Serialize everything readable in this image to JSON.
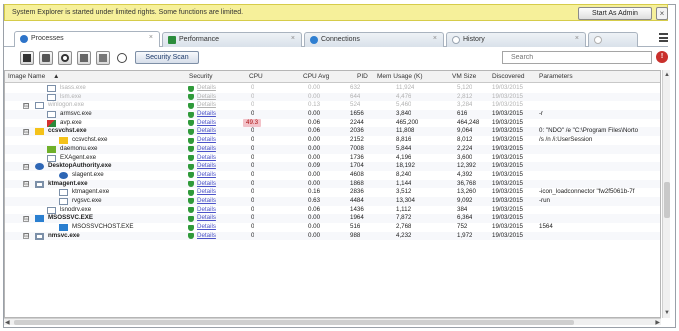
{
  "notice": {
    "text": "System Explorer is started under limited rights. Some functions are limited.",
    "admin_button": "Start As Admin",
    "close_button": "×"
  },
  "tabs": [
    {
      "label": "Processes",
      "icon_color": "#2e74c9",
      "active": true
    },
    {
      "label": "Performance",
      "icon_color": "#2b8c3c",
      "active": false
    },
    {
      "label": "Connections",
      "icon_color": "#2f7fd1",
      "active": false
    },
    {
      "label": "History",
      "icon_color": "#9aa5b1",
      "active": false
    },
    {
      "label": "",
      "icon_color": "#b0b0b0",
      "active": false
    }
  ],
  "tab_close_glyph": "×",
  "toolbar": {
    "scan_button": "Security Scan",
    "search_placeholder": "Search",
    "search_icon": "!"
  },
  "grid": {
    "columns": [
      "Image Name",
      "Security",
      "CPU",
      "CPU Avg",
      "PID",
      "Mem Usage (K)",
      "VM Size",
      "Discovered",
      "Parameters"
    ],
    "rows": [
      {
        "name": "lsass.exe",
        "indent": 1,
        "expander": "",
        "icon": "window",
        "faded": true,
        "bold": false,
        "security": "Details",
        "cpu": "0",
        "cpu_avg": "0.00",
        "pid": "632",
        "mem": "11,924",
        "vm": "5,120",
        "discovered": "19/03/2015",
        "params": ""
      },
      {
        "name": "lsm.exe",
        "indent": 1,
        "expander": "",
        "icon": "window",
        "faded": true,
        "bold": false,
        "security": "Details",
        "cpu": "0",
        "cpu_avg": "0.00",
        "pid": "644",
        "mem": "4,476",
        "vm": "2,812",
        "discovered": "19/03/2015",
        "params": ""
      },
      {
        "name": "winlogon.exe",
        "indent": 0,
        "expander": "⊟",
        "icon": "window",
        "faded": true,
        "bold": false,
        "security": "Details",
        "cpu": "0",
        "cpu_avg": "0.13",
        "pid": "524",
        "mem": "5,460",
        "vm": "3,284",
        "discovered": "19/03/2015",
        "params": ""
      },
      {
        "name": "armsvc.exe",
        "indent": 1,
        "expander": "",
        "icon": "window",
        "faded": false,
        "bold": false,
        "security": "Details",
        "cpu": "0",
        "cpu_avg": "0.00",
        "pid": "1656",
        "mem": "3,840",
        "vm": "616",
        "discovered": "19/03/2015",
        "params": "-r"
      },
      {
        "name": "avp.exe",
        "indent": 1,
        "expander": "",
        "icon": "kaspersky",
        "faded": false,
        "bold": false,
        "security": "Details",
        "cpu": "49.3",
        "cpu_avg": "0.06",
        "pid": "2244",
        "mem": "465,200",
        "vm": "464,248",
        "discovered": "19/03/2015",
        "params": ""
      },
      {
        "name": "ccsvchst.exe",
        "indent": 0,
        "expander": "⊟",
        "icon": "check",
        "faded": false,
        "bold": true,
        "security": "Details",
        "cpu": "0",
        "cpu_avg": "0.06",
        "pid": "2036",
        "mem": "11,808",
        "vm": "9,064",
        "discovered": "19/03/2015",
        "params": "0: \"NDO\" /e \"C:\\Program Files\\Norto"
      },
      {
        "name": "ccsvchst.exe",
        "indent": 2,
        "expander": "",
        "icon": "check",
        "faded": false,
        "bold": false,
        "security": "Details",
        "cpu": "0",
        "cpu_avg": "0.00",
        "pid": "2152",
        "mem": "8,816",
        "vm": "8,012",
        "discovered": "19/03/2015",
        "params": "/s /n /i:UserSession"
      },
      {
        "name": "daemonu.exe",
        "indent": 1,
        "expander": "",
        "icon": "nvidia",
        "faded": false,
        "bold": false,
        "security": "Details",
        "cpu": "0",
        "cpu_avg": "0.00",
        "pid": "7008",
        "mem": "5,844",
        "vm": "2,224",
        "discovered": "19/03/2015",
        "params": ""
      },
      {
        "name": "EXAgent.exe",
        "indent": 1,
        "expander": "",
        "icon": "window",
        "faded": false,
        "bold": false,
        "security": "Details",
        "cpu": "0",
        "cpu_avg": "0.00",
        "pid": "1736",
        "mem": "4,196",
        "vm": "3,600",
        "discovered": "19/03/2015",
        "params": ""
      },
      {
        "name": "DesktopAuthority.exe",
        "indent": 0,
        "expander": "⊟",
        "icon": "globe",
        "faded": false,
        "bold": true,
        "security": "Details",
        "cpu": "0",
        "cpu_avg": "0.09",
        "pid": "1704",
        "mem": "18,192",
        "vm": "12,392",
        "discovered": "19/03/2015",
        "params": ""
      },
      {
        "name": "slagent.exe",
        "indent": 2,
        "expander": "",
        "icon": "globe",
        "faded": false,
        "bold": false,
        "security": "Details",
        "cpu": "0",
        "cpu_avg": "0.00",
        "pid": "4608",
        "mem": "8,240",
        "vm": "4,392",
        "discovered": "19/03/2015",
        "params": ""
      },
      {
        "name": "ktmagent.exe",
        "indent": 0,
        "expander": "⊟",
        "icon": "window",
        "faded": false,
        "bold": true,
        "security": "Details",
        "cpu": "0",
        "cpu_avg": "0.00",
        "pid": "1868",
        "mem": "1,144",
        "vm": "36,768",
        "discovered": "19/03/2015",
        "params": ""
      },
      {
        "name": "ktmagent.exe",
        "indent": 2,
        "expander": "",
        "icon": "window",
        "faded": false,
        "bold": false,
        "security": "Details",
        "cpu": "0",
        "cpu_avg": "0.16",
        "pid": "2836",
        "mem": "3,512",
        "vm": "13,260",
        "discovered": "19/03/2015",
        "params": "-icon_loadconnector \"fw2f5061b-7f"
      },
      {
        "name": "rvgsvc.exe",
        "indent": 2,
        "expander": "",
        "icon": "window",
        "faded": false,
        "bold": false,
        "security": "Details",
        "cpu": "0",
        "cpu_avg": "0.63",
        "pid": "4484",
        "mem": "13,304",
        "vm": "9,092",
        "discovered": "19/03/2015",
        "params": "-run"
      },
      {
        "name": "lsnodrv.exe",
        "indent": 1,
        "expander": "",
        "icon": "window",
        "faded": false,
        "bold": false,
        "security": "Details",
        "cpu": "0",
        "cpu_avg": "0.06",
        "pid": "1436",
        "mem": "1,112",
        "vm": "384",
        "discovered": "19/03/2015",
        "params": ""
      },
      {
        "name": "MSOSSVC.EXE",
        "indent": 0,
        "expander": "⊟",
        "icon": "blue",
        "faded": false,
        "bold": true,
        "security": "Details",
        "cpu": "0",
        "cpu_avg": "0.00",
        "pid": "1964",
        "mem": "7,872",
        "vm": "6,364",
        "discovered": "19/03/2015",
        "params": ""
      },
      {
        "name": "MSOSSVCHOST.EXE",
        "indent": 2,
        "expander": "",
        "icon": "blue",
        "faded": false,
        "bold": false,
        "security": "Details",
        "cpu": "0",
        "cpu_avg": "0.00",
        "pid": "516",
        "mem": "2,768",
        "vm": "752",
        "discovered": "19/03/2015",
        "params": "1564"
      },
      {
        "name": "nmsvc.exe",
        "indent": 0,
        "expander": "⊟",
        "icon": "window",
        "faded": false,
        "bold": true,
        "security": "Details",
        "cpu": "0",
        "cpu_avg": "0.00",
        "pid": "988",
        "mem": "4,232",
        "vm": "1,972",
        "discovered": "19/03/2015",
        "params": ""
      }
    ]
  },
  "colors": {
    "notice_bg": "#f6f09a",
    "link": "#4b52c8",
    "shield": "#2f9a3a",
    "cpu_highlight": "#f3c2c9"
  },
  "icons": {
    "window": "process-window-icon",
    "kaspersky": "kaspersky-icon",
    "check": "norton-check-icon",
    "nvidia": "nvidia-icon",
    "globe": "globe-icon",
    "blue": "blue-app-icon"
  }
}
